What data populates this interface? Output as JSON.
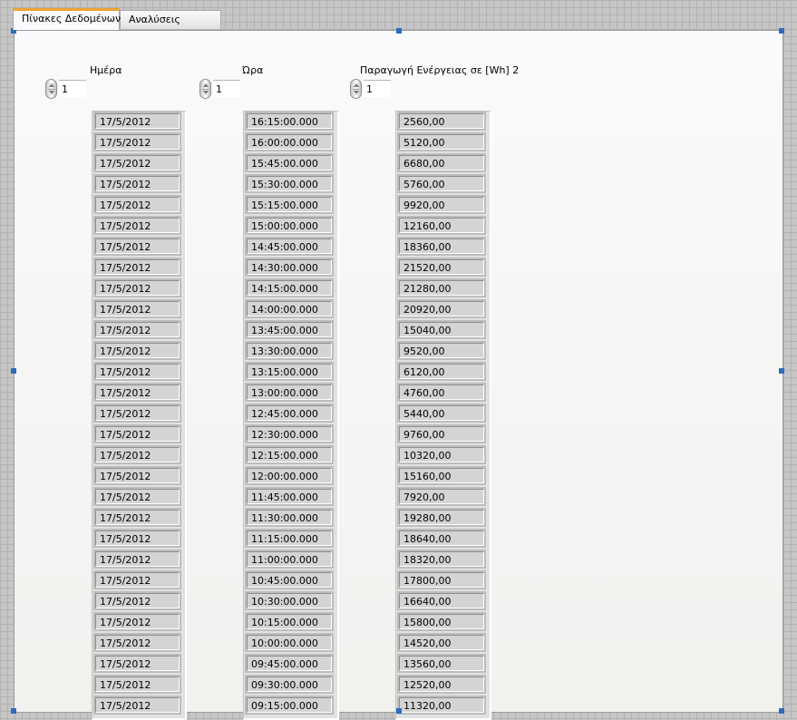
{
  "tabs": [
    {
      "label": "Πίνακες Δεδομένων",
      "active": true
    },
    {
      "label": "Αναλύσεις",
      "active": false
    }
  ],
  "columns": [
    {
      "label": "Ημέρα",
      "index": "1",
      "values": [
        "17/5/2012",
        "17/5/2012",
        "17/5/2012",
        "17/5/2012",
        "17/5/2012",
        "17/5/2012",
        "17/5/2012",
        "17/5/2012",
        "17/5/2012",
        "17/5/2012",
        "17/5/2012",
        "17/5/2012",
        "17/5/2012",
        "17/5/2012",
        "17/5/2012",
        "17/5/2012",
        "17/5/2012",
        "17/5/2012",
        "17/5/2012",
        "17/5/2012",
        "17/5/2012",
        "17/5/2012",
        "17/5/2012",
        "17/5/2012",
        "17/5/2012",
        "17/5/2012",
        "17/5/2012",
        "17/5/2012",
        "17/5/2012"
      ]
    },
    {
      "label": "Ώρα",
      "index": "1",
      "values": [
        "16:15:00.000",
        "16:00:00.000",
        "15:45:00.000",
        "15:30:00.000",
        "15:15:00.000",
        "15:00:00.000",
        "14:45:00.000",
        "14:30:00.000",
        "14:15:00.000",
        "14:00:00.000",
        "13:45:00.000",
        "13:30:00.000",
        "13:15:00.000",
        "13:00:00.000",
        "12:45:00.000",
        "12:30:00.000",
        "12:15:00.000",
        "12:00:00.000",
        "11:45:00.000",
        "11:30:00.000",
        "11:15:00.000",
        "11:00:00.000",
        "10:45:00.000",
        "10:30:00.000",
        "10:15:00.000",
        "10:00:00.000",
        "09:45:00.000",
        "09:30:00.000",
        "09:15:00.000"
      ]
    },
    {
      "label": "Παραγωγή Ενέργειας σε [Wh] 2",
      "index": "1",
      "values": [
        "2560,00",
        "5120,00",
        "6680,00",
        "5760,00",
        "9920,00",
        "12160,00",
        "18360,00",
        "21520,00",
        "21280,00",
        "20920,00",
        "15040,00",
        "9520,00",
        "6120,00",
        "4760,00",
        "5440,00",
        "9760,00",
        "10320,00",
        "15160,00",
        "7920,00",
        "19280,00",
        "18640,00",
        "18320,00",
        "17800,00",
        "16640,00",
        "15800,00",
        "14520,00",
        "13560,00",
        "12520,00",
        "11320,00"
      ]
    }
  ]
}
